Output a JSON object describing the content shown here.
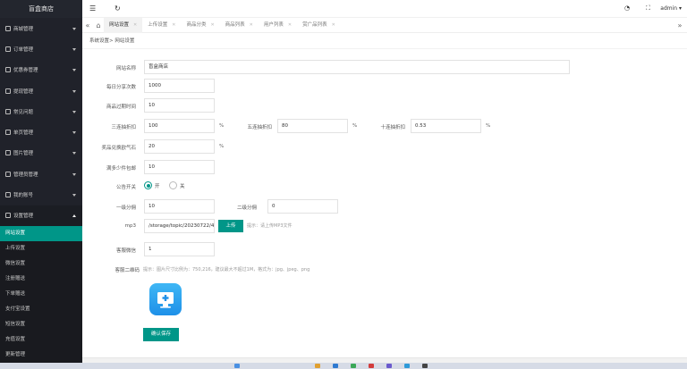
{
  "sidebar": {
    "logo": "盲盒商店",
    "menu": [
      {
        "label": "商城管理"
      },
      {
        "label": "订单管理"
      },
      {
        "label": "优惠券管理"
      },
      {
        "label": "提现管理"
      },
      {
        "label": "常见问题"
      },
      {
        "label": "单页管理"
      },
      {
        "label": "图片管理"
      },
      {
        "label": "管理员管理"
      },
      {
        "label": "我的账号"
      },
      {
        "label": "设置管理"
      }
    ],
    "submenu": [
      {
        "label": "网站设置"
      },
      {
        "label": "上传设置"
      },
      {
        "label": "微信设置"
      },
      {
        "label": "注册赠送"
      },
      {
        "label": "下单赠送"
      },
      {
        "label": "支付宝设置"
      },
      {
        "label": "短信设置"
      },
      {
        "label": "充值设置"
      },
      {
        "label": "更新管理"
      }
    ]
  },
  "header": {
    "user": "admin ▾"
  },
  "tabs": [
    {
      "label": "网站设置"
    },
    {
      "label": "上传设置"
    },
    {
      "label": "商品分类"
    },
    {
      "label": "商品列表"
    },
    {
      "label": "用户列表"
    },
    {
      "label": "赏广品列表"
    }
  ],
  "breadcrumb": "系统设置>  网站设置",
  "form": {
    "site_name": {
      "label": "网站名称",
      "value": "盲盒商店"
    },
    "daily_share": {
      "label": "每日分享次数",
      "value": "1000"
    },
    "expire_time": {
      "label": "商品过期时间",
      "value": "10"
    },
    "discount3": {
      "label": "三连抽折扣",
      "value": "100"
    },
    "discount5": {
      "label": "五连抽折扣",
      "value": "80"
    },
    "discount10": {
      "label": "十连抽折扣",
      "value": "0.53"
    },
    "prize_rate": {
      "label": "奖品兑换欧气石",
      "value": "20"
    },
    "free_ship": {
      "label": "满多少件包邮",
      "value": "10"
    },
    "pct": "%",
    "announce": {
      "label": "公告开关",
      "on": "开",
      "off": "关"
    },
    "commission1": {
      "label": "一级分佣",
      "value": "10"
    },
    "commission2": {
      "label": "二级分佣",
      "value": "0"
    },
    "mp3": {
      "label": "mp3",
      "value": "/storage/topic/20230722/435",
      "button": "上传",
      "hint": "提示：请上传MP3文件"
    },
    "service_wechat": {
      "label": "客服微信",
      "value": "1"
    },
    "service_qr": {
      "label": "客服二维码",
      "hint": "提示：图片尺寸比例为：750,216，建议最大不超过1M，格式为：jpg、jpeg、png"
    },
    "submit": "确认保存"
  }
}
